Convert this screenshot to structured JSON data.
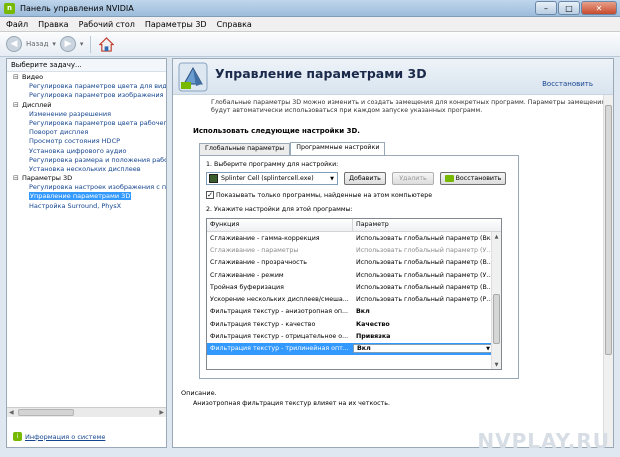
{
  "window": {
    "title": "Панель управления NVIDIA",
    "min": "–",
    "max": "□",
    "close": "✕"
  },
  "menu": [
    "Файл",
    "Правка",
    "Рабочий стол",
    "Параметры 3D",
    "Справка"
  ],
  "toolbar": {
    "back_label": "Назад"
  },
  "left": {
    "header": "Выберите задачу...",
    "tree": [
      {
        "type": "grp",
        "label": "Видео"
      },
      {
        "type": "leaf",
        "label": "Регулировка параметров цвета для вид"
      },
      {
        "type": "leaf",
        "label": "Регулировка параметров изображения д"
      },
      {
        "type": "grp",
        "label": "Дисплей"
      },
      {
        "type": "leaf",
        "label": "Изменение разрешения"
      },
      {
        "type": "leaf",
        "label": "Регулировка параметров цвета рабочег"
      },
      {
        "type": "leaf",
        "label": "Поворот дисплея"
      },
      {
        "type": "leaf",
        "label": "Просмотр состояния HDCP"
      },
      {
        "type": "leaf",
        "label": "Установка цифрового аудио"
      },
      {
        "type": "leaf",
        "label": "Регулировка размера и положения рабо"
      },
      {
        "type": "leaf",
        "label": "Установка нескольких дисплеев"
      },
      {
        "type": "grp",
        "label": "Параметры 3D"
      },
      {
        "type": "leaf",
        "label": "Регулировка настроек изображения с пр"
      },
      {
        "type": "leaf",
        "label": "Управление параметрами 3D",
        "selected": true
      },
      {
        "type": "leaf",
        "label": "Настройка Surround, PhysX"
      }
    ],
    "sysinfo": "Информация о системе"
  },
  "main": {
    "title": "Управление параметрами 3D",
    "restore": "Восстановить",
    "description": "Глобальные параметры 3D можно изменить и создать замещения для конкретных программ. Параметры замещения будут автоматически использоваться при каждом запуске указанных программ.",
    "section": "Использовать следующие настройки 3D.",
    "tabs": [
      "Глобальные параметры",
      "Программные настройки"
    ],
    "step1": "1. Выберите программу для настройки:",
    "program": "Splinter Cell (splintercell.exe)",
    "btn_add": "Добавить",
    "btn_delete": "Удалить",
    "btn_restore": "Восстановить",
    "checkbox": "Показывать только программы, найденные на этом компьютере",
    "step2": "2. Укажите настройки для этой программы:",
    "grid_headers": [
      "Функция",
      "Параметр"
    ],
    "rows": [
      {
        "f": "Сглаживание - гамма-коррекция",
        "p": "Использовать глобальный параметр (Вкл)",
        "s": ""
      },
      {
        "f": "Сглаживание - параметры",
        "p": "Использовать глобальный параметр (У...",
        "s": "dim"
      },
      {
        "f": "Сглаживание - прозрачность",
        "p": "Использовать глобальный параметр (В...",
        "s": ""
      },
      {
        "f": "Сглаживание - режим",
        "p": "Использовать глобальный параметр (У...",
        "s": ""
      },
      {
        "f": "Тройная буферизация",
        "p": "Использовать глобальный параметр (В...",
        "s": ""
      },
      {
        "f": "Ускорение нескольких дисплеев/смеша...",
        "p": "Использовать глобальный параметр (Р...",
        "s": ""
      },
      {
        "f": "Фильтрация текстур - анизотропная оп...",
        "p": "Вкл",
        "s": "bold"
      },
      {
        "f": "Фильтрация текстур - качество",
        "p": "Качество",
        "s": "bold"
      },
      {
        "f": "Фильтрация текстур - отрицательное о...",
        "p": "Привязка",
        "s": "bold"
      },
      {
        "f": "Фильтрация текстур - трилинейная опт...",
        "p": "Вкл",
        "s": "sel"
      }
    ],
    "description_label": "Описание.",
    "description_text": "Анизотропная фильтрация текстур влияет на их четкость."
  },
  "watermark": "NVPLAY.RU",
  "icons": {
    "back": "arrow-left-icon",
    "forward": "arrow-right-icon",
    "home": "home-icon"
  },
  "colors": {
    "nvidia_green": "#76b900",
    "selection": "#3399ff"
  }
}
